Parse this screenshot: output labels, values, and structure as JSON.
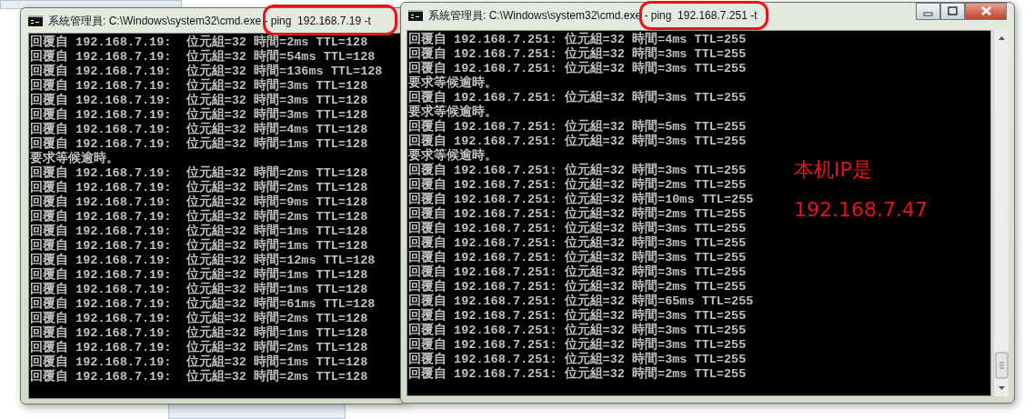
{
  "windows": [
    {
      "title": "系統管理員: C:\\Windows\\system32\\cmd.exe - ping  192.168.7.19 -t",
      "highlight": true,
      "controls_visible": false,
      "scrollbar": false,
      "lines": [
        "回覆自 192.168.7.19:  位元組=32 時間=2ms TTL=128",
        "回覆自 192.168.7.19:  位元組=32 時間=54ms TTL=128",
        "回覆自 192.168.7.19:  位元組=32 時間=136ms TTL=128",
        "回覆自 192.168.7.19:  位元組=32 時間=3ms TTL=128",
        "回覆自 192.168.7.19:  位元組=32 時間=3ms TTL=128",
        "回覆自 192.168.7.19:  位元組=32 時間=3ms TTL=128",
        "回覆自 192.168.7.19:  位元組=32 時間=4ms TTL=128",
        "回覆自 192.168.7.19:  位元組=32 時間=1ms TTL=128",
        "要求等候逾時。",
        "回覆自 192.168.7.19:  位元組=32 時間=2ms TTL=128",
        "回覆自 192.168.7.19:  位元組=32 時間=2ms TTL=128",
        "回覆自 192.168.7.19:  位元組=32 時間=9ms TTL=128",
        "回覆自 192.168.7.19:  位元組=32 時間=2ms TTL=128",
        "回覆自 192.168.7.19:  位元組=32 時間=1ms TTL=128",
        "回覆自 192.168.7.19:  位元組=32 時間=1ms TTL=128",
        "回覆自 192.168.7.19:  位元組=32 時間=12ms TTL=128",
        "回覆自 192.168.7.19:  位元組=32 時間=1ms TTL=128",
        "回覆自 192.168.7.19:  位元組=32 時間=1ms TTL=128",
        "回覆自 192.168.7.19:  位元組=32 時間=61ms TTL=128",
        "回覆自 192.168.7.19:  位元組=32 時間=2ms TTL=128",
        "回覆自 192.168.7.19:  位元組=32 時間=1ms TTL=128",
        "回覆自 192.168.7.19:  位元組=32 時間=2ms TTL=128",
        "回覆自 192.168.7.19:  位元組=32 時間=1ms TTL=128",
        "回覆自 192.168.7.19:  位元組=32 時間=2ms TTL=128"
      ]
    },
    {
      "title": "系統管理員: C:\\Windows\\system32\\cmd.exe - ping  192.168.7.251 -t",
      "highlight": true,
      "controls_visible": true,
      "scrollbar": true,
      "lines": [
        "回覆自 192.168.7.251: 位元組=32 時間=4ms TTL=255",
        "回覆自 192.168.7.251: 位元組=32 時間=3ms TTL=255",
        "回覆自 192.168.7.251: 位元組=32 時間=3ms TTL=255",
        "要求等候逾時。",
        "回覆自 192.168.7.251: 位元組=32 時間=3ms TTL=255",
        "要求等候逾時。",
        "回覆自 192.168.7.251: 位元組=32 時間=5ms TTL=255",
        "回覆自 192.168.7.251: 位元組=32 時間=3ms TTL=255",
        "要求等候逾時。",
        "回覆自 192.168.7.251: 位元組=32 時間=3ms TTL=255",
        "回覆自 192.168.7.251: 位元組=32 時間=2ms TTL=255",
        "回覆自 192.168.7.251: 位元組=32 時間=10ms TTL=255",
        "回覆自 192.168.7.251: 位元組=32 時間=2ms TTL=255",
        "回覆自 192.168.7.251: 位元組=32 時間=3ms TTL=255",
        "回覆自 192.168.7.251: 位元組=32 時間=3ms TTL=255",
        "回覆自 192.168.7.251: 位元組=32 時間=3ms TTL=255",
        "回覆自 192.168.7.251: 位元組=32 時間=3ms TTL=255",
        "回覆自 192.168.7.251: 位元組=32 時間=2ms TTL=255",
        "回覆自 192.168.7.251: 位元組=32 時間=65ms TTL=255",
        "回覆自 192.168.7.251: 位元組=32 時間=3ms TTL=255",
        "回覆自 192.168.7.251: 位元組=32 時間=3ms TTL=255",
        "回覆自 192.168.7.251: 位元組=32 時間=3ms TTL=255",
        "回覆自 192.168.7.251: 位元組=32 時間=3ms TTL=255",
        "回覆自 192.168.7.251: 位元組=32 時間=2ms TTL=255"
      ]
    }
  ],
  "annotation": {
    "lines": [
      "本机IP是",
      "192.168.7.47"
    ]
  }
}
